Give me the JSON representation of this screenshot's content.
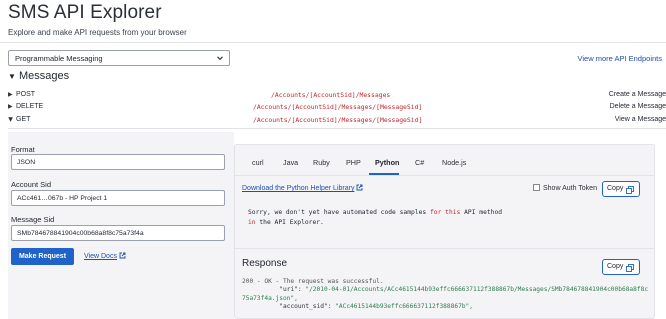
{
  "header": {
    "title": "SMS API Explorer",
    "subtitle": "Explore and make API requests from your browser"
  },
  "product_select": {
    "value": "Programmable Messaging"
  },
  "view_more_link": "View more API Endpoints",
  "section": {
    "title": "Messages"
  },
  "endpoints": [
    {
      "method": "POST",
      "path": "/Accounts/[AccountSid]/Messages",
      "description": "Create a Message"
    },
    {
      "method": "DELETE",
      "path": "/Accounts/[AccountSid]/Messages/[MessageSid]",
      "description": "Delete a Message"
    },
    {
      "method": "GET",
      "path": "/Accounts/[AccountSid]/Messages/[MessageSid]",
      "description": "View a Message"
    }
  ],
  "form": {
    "format_label": "Format",
    "format_value": "JSON",
    "account_sid_label": "Account Sid",
    "account_sid_value": "ACc461…067b - HP Project 1",
    "message_sid_label": "Message Sid",
    "message_sid_value": "SMb784678841904c00b68a8f8c75a73f4a",
    "make_request": "Make Request",
    "view_docs": "View Docs"
  },
  "code_tabs": [
    "curl",
    "Java",
    "Ruby",
    "PHP",
    "Python",
    "C#",
    "Node.js"
  ],
  "active_tab": "Python",
  "helper_link": "Download the Python Helper Library",
  "show_auth_token": "Show Auth Token",
  "copy_label": "Copy",
  "code_message": {
    "line1_a": "Sorry, we don't yet have automated code samples ",
    "line1_for": "for",
    "line1_b": " ",
    "line1_this": "this",
    "line1_c": " API method",
    "line2_in": "in",
    "line2_b": " the API Explorer."
  },
  "response": {
    "title": "Response",
    "status_line": "200 - OK - The request was successful.",
    "uri_key": "\"uri\": ",
    "uri_value": "\"/2010-04-01/Accounts/ACc4615144b93effc666637112f388867b/Messages/SMb784678841904c00b68a8f8c",
    "uri_value2": "75a73f4a.json\",",
    "account_key": "\"account_sid\": ",
    "account_value": "\"ACc4615144b93effc666637112f388867b\","
  },
  "colors": {
    "accent": "#1f62c9",
    "path_red": "#c0272d",
    "link": "#1f4fa8",
    "string_green": "#2e7d4f"
  }
}
